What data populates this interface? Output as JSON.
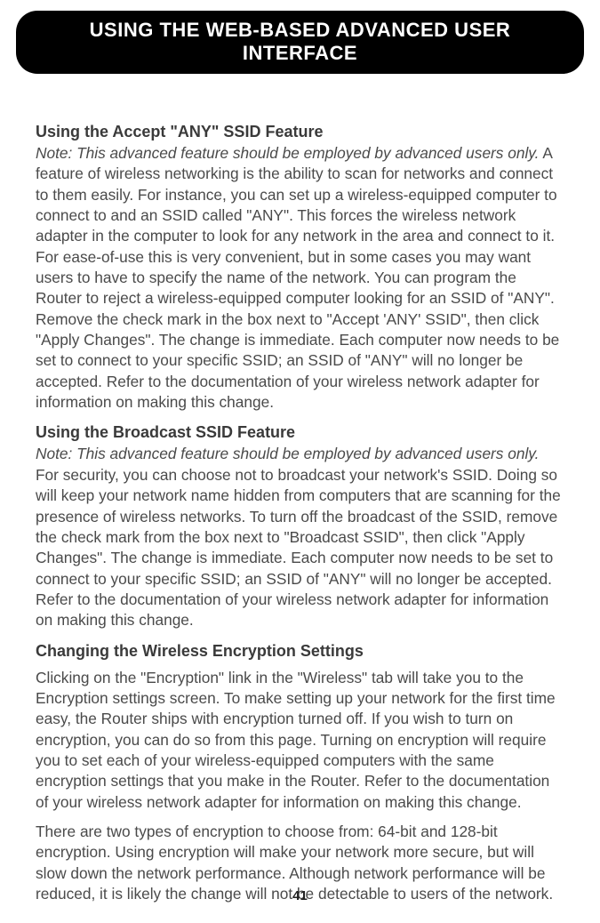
{
  "header": {
    "title": "USING THE WEB-BASED ADVANCED USER INTERFACE"
  },
  "sections": {
    "s1": {
      "title": "Using the Accept \"ANY\" SSID Feature",
      "note": "Note: This advanced feature should be employed by advanced users only.",
      "body": " A feature of wireless networking is the ability to scan for networks and connect to them easily. For instance, you can set up a wireless-equipped computer to connect to and an SSID called \"ANY\". This forces the wireless network adapter in the computer to look for any network in the area and connect to it. For ease-of-use this is very convenient, but in some cases you may want users to have to specify the name of the network. You can program the Router to reject a wireless-equipped computer looking for an SSID of \"ANY\". Remove the check mark in the box next to \"Accept 'ANY' SSID\", then click \"Apply Changes\". The change is immediate. Each computer now needs to be set to connect to your specific SSID; an SSID of \"ANY\" will no longer be accepted. Refer to the documentation of your wireless network adapter for information on making this change."
    },
    "s2": {
      "title": "Using the Broadcast SSID Feature",
      "note": "Note: This advanced feature should be employed by advanced users only.",
      "body": " For security, you can choose not to broadcast your network's SSID. Doing so will keep your network name hidden from computers that are scanning for the presence of wireless networks. To turn off the broadcast of the SSID, remove the check mark from the box next to \"Broadcast SSID\", then click \"Apply Changes\". The change is immediate. Each computer now needs to be set to connect to your specific SSID; an SSID of \"ANY\" will no longer be accepted. Refer to the documentation of your wireless network adapter for information on making this change."
    },
    "s3": {
      "title": "Changing the Wireless Encryption Settings",
      "p1": "Clicking on the \"Encryption\" link in the \"Wireless\" tab will take you to the Encryption settings screen. To make setting up your network for the first time easy, the Router ships with encryption turned off. If you wish to turn on encryption, you can do so from this page. Turning on encryption will require you to set each of your wireless-equipped computers with the same encryption settings that you make in the Router. Refer to the documentation of your wireless network adapter for information on making this change.",
      "p2": "There are two types of encryption to choose from: 64-bit and 128-bit encryption. Using encryption will make your network more secure, but will slow down the network performance. Although network performance will be reduced, it is likely the change will not be detectable to users of the network."
    }
  },
  "page_number": "41"
}
